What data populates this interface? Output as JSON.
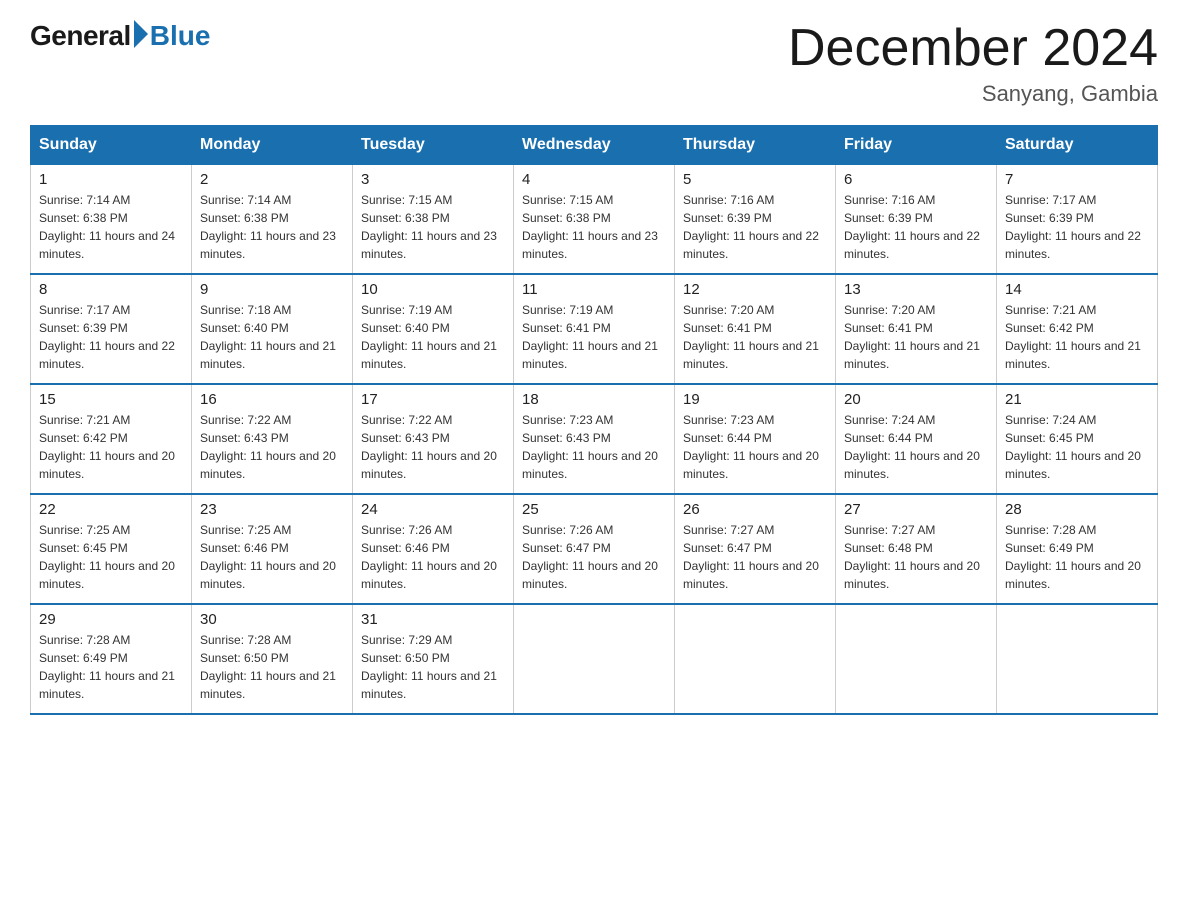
{
  "header": {
    "logo_general": "General",
    "logo_blue": "Blue",
    "title": "December 2024",
    "location": "Sanyang, Gambia"
  },
  "days_of_week": [
    "Sunday",
    "Monday",
    "Tuesday",
    "Wednesday",
    "Thursday",
    "Friday",
    "Saturday"
  ],
  "weeks": [
    [
      {
        "day": "1",
        "sunrise": "7:14 AM",
        "sunset": "6:38 PM",
        "daylight": "11 hours and 24 minutes."
      },
      {
        "day": "2",
        "sunrise": "7:14 AM",
        "sunset": "6:38 PM",
        "daylight": "11 hours and 23 minutes."
      },
      {
        "day": "3",
        "sunrise": "7:15 AM",
        "sunset": "6:38 PM",
        "daylight": "11 hours and 23 minutes."
      },
      {
        "day": "4",
        "sunrise": "7:15 AM",
        "sunset": "6:38 PM",
        "daylight": "11 hours and 23 minutes."
      },
      {
        "day": "5",
        "sunrise": "7:16 AM",
        "sunset": "6:39 PM",
        "daylight": "11 hours and 22 minutes."
      },
      {
        "day": "6",
        "sunrise": "7:16 AM",
        "sunset": "6:39 PM",
        "daylight": "11 hours and 22 minutes."
      },
      {
        "day": "7",
        "sunrise": "7:17 AM",
        "sunset": "6:39 PM",
        "daylight": "11 hours and 22 minutes."
      }
    ],
    [
      {
        "day": "8",
        "sunrise": "7:17 AM",
        "sunset": "6:39 PM",
        "daylight": "11 hours and 22 minutes."
      },
      {
        "day": "9",
        "sunrise": "7:18 AM",
        "sunset": "6:40 PM",
        "daylight": "11 hours and 21 minutes."
      },
      {
        "day": "10",
        "sunrise": "7:19 AM",
        "sunset": "6:40 PM",
        "daylight": "11 hours and 21 minutes."
      },
      {
        "day": "11",
        "sunrise": "7:19 AM",
        "sunset": "6:41 PM",
        "daylight": "11 hours and 21 minutes."
      },
      {
        "day": "12",
        "sunrise": "7:20 AM",
        "sunset": "6:41 PM",
        "daylight": "11 hours and 21 minutes."
      },
      {
        "day": "13",
        "sunrise": "7:20 AM",
        "sunset": "6:41 PM",
        "daylight": "11 hours and 21 minutes."
      },
      {
        "day": "14",
        "sunrise": "7:21 AM",
        "sunset": "6:42 PM",
        "daylight": "11 hours and 21 minutes."
      }
    ],
    [
      {
        "day": "15",
        "sunrise": "7:21 AM",
        "sunset": "6:42 PM",
        "daylight": "11 hours and 20 minutes."
      },
      {
        "day": "16",
        "sunrise": "7:22 AM",
        "sunset": "6:43 PM",
        "daylight": "11 hours and 20 minutes."
      },
      {
        "day": "17",
        "sunrise": "7:22 AM",
        "sunset": "6:43 PM",
        "daylight": "11 hours and 20 minutes."
      },
      {
        "day": "18",
        "sunrise": "7:23 AM",
        "sunset": "6:43 PM",
        "daylight": "11 hours and 20 minutes."
      },
      {
        "day": "19",
        "sunrise": "7:23 AM",
        "sunset": "6:44 PM",
        "daylight": "11 hours and 20 minutes."
      },
      {
        "day": "20",
        "sunrise": "7:24 AM",
        "sunset": "6:44 PM",
        "daylight": "11 hours and 20 minutes."
      },
      {
        "day": "21",
        "sunrise": "7:24 AM",
        "sunset": "6:45 PM",
        "daylight": "11 hours and 20 minutes."
      }
    ],
    [
      {
        "day": "22",
        "sunrise": "7:25 AM",
        "sunset": "6:45 PM",
        "daylight": "11 hours and 20 minutes."
      },
      {
        "day": "23",
        "sunrise": "7:25 AM",
        "sunset": "6:46 PM",
        "daylight": "11 hours and 20 minutes."
      },
      {
        "day": "24",
        "sunrise": "7:26 AM",
        "sunset": "6:46 PM",
        "daylight": "11 hours and 20 minutes."
      },
      {
        "day": "25",
        "sunrise": "7:26 AM",
        "sunset": "6:47 PM",
        "daylight": "11 hours and 20 minutes."
      },
      {
        "day": "26",
        "sunrise": "7:27 AM",
        "sunset": "6:47 PM",
        "daylight": "11 hours and 20 minutes."
      },
      {
        "day": "27",
        "sunrise": "7:27 AM",
        "sunset": "6:48 PM",
        "daylight": "11 hours and 20 minutes."
      },
      {
        "day": "28",
        "sunrise": "7:28 AM",
        "sunset": "6:49 PM",
        "daylight": "11 hours and 20 minutes."
      }
    ],
    [
      {
        "day": "29",
        "sunrise": "7:28 AM",
        "sunset": "6:49 PM",
        "daylight": "11 hours and 21 minutes."
      },
      {
        "day": "30",
        "sunrise": "7:28 AM",
        "sunset": "6:50 PM",
        "daylight": "11 hours and 21 minutes."
      },
      {
        "day": "31",
        "sunrise": "7:29 AM",
        "sunset": "6:50 PM",
        "daylight": "11 hours and 21 minutes."
      },
      null,
      null,
      null,
      null
    ]
  ],
  "labels": {
    "sunrise": "Sunrise:",
    "sunset": "Sunset:",
    "daylight": "Daylight:"
  }
}
